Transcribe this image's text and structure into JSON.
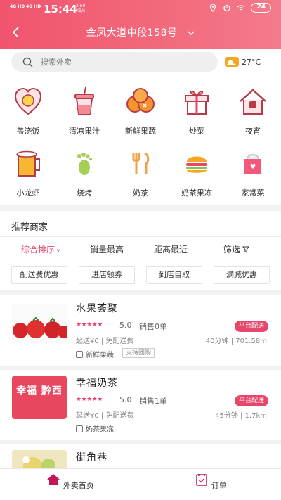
{
  "status_bar": {
    "signal_1": "4G HD",
    "signal_2": "4G HD",
    "time": "15:44",
    "speed_value": "2.50",
    "speed_unit": "KB/s",
    "battery": "24"
  },
  "nav": {
    "location": "金凤大道中段158号"
  },
  "search": {
    "placeholder": "搜索外卖",
    "weather_temp": "27°C"
  },
  "categories": [
    {
      "label": "盖浇饭",
      "icon": "rice-bowl-icon"
    },
    {
      "label": "清凉果汁",
      "icon": "juice-icon"
    },
    {
      "label": "新鲜果蔬",
      "icon": "orange-icon"
    },
    {
      "label": "炒菜",
      "icon": "gift-box-icon"
    },
    {
      "label": "夜宵",
      "icon": "house-icon"
    },
    {
      "label": "小龙虾",
      "icon": "beer-icon"
    },
    {
      "label": "烧烤",
      "icon": "footprint-icon"
    },
    {
      "label": "奶茶",
      "icon": "fork-knife-icon"
    },
    {
      "label": "奶茶果冻",
      "icon": "burger-icon"
    },
    {
      "label": "家常菜",
      "icon": "gift-bag-icon"
    }
  ],
  "recommend": {
    "title": "推荐商家",
    "sorts": [
      "综合排序",
      "销量最高",
      "距离最近",
      "筛选"
    ],
    "chips": [
      "配送费优惠",
      "进店领券",
      "到店自取",
      "满减优惠"
    ]
  },
  "shops": [
    {
      "name": "水果荟聚",
      "stars": "★★★★★",
      "rating": "5.0",
      "sales": "销售0单",
      "badge": "平台配送",
      "fee": "起送¥0 | 免配送费",
      "distance": "40分钟 | 701.58m",
      "tag": "新鲜果蔬",
      "tag2": "支持团购"
    },
    {
      "name": "幸福奶茶",
      "thumb_text": "幸福 黔西",
      "stars": "★★★★★",
      "rating": "5.0",
      "sales": "销售1单",
      "badge": "平台配送",
      "fee": "起送¥0 | 免配送费",
      "distance": "45分钟 | 1.7km",
      "tag": "奶茶果冻"
    },
    {
      "name": "街角巷"
    }
  ],
  "tabs": [
    {
      "label": "外卖首页",
      "icon": "home-icon"
    },
    {
      "label": "订单",
      "icon": "order-icon"
    }
  ],
  "colors": {
    "brand": "#f1546e",
    "accent": "#e8476c"
  }
}
